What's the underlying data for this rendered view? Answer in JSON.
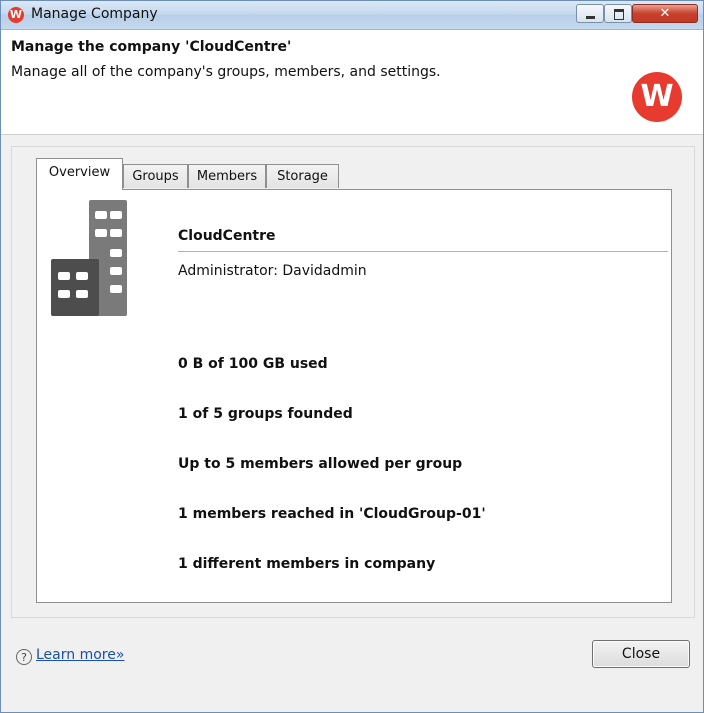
{
  "window": {
    "app_icon_letter": "W",
    "title": "Manage Company",
    "minimize_glyph": "",
    "maximize_glyph": "",
    "close_glyph": "✕"
  },
  "header": {
    "title": "Manage the company 'CloudCentre'",
    "subtitle": "Manage all of the company's groups, members, and settings.",
    "logo_letter": "W"
  },
  "tabs": [
    {
      "label": "Overview",
      "active": true
    },
    {
      "label": "Groups",
      "active": false
    },
    {
      "label": "Members",
      "active": false
    },
    {
      "label": "Storage",
      "active": false
    }
  ],
  "overview": {
    "company_name": "CloudCentre",
    "administrator": "Administrator: Davidadmin",
    "stats": [
      "0 B of 100 GB used",
      "1 of 5 groups founded",
      "Up to 5 members allowed per group",
      "1 members reached in 'CloudGroup-01'",
      "1 different members in company"
    ]
  },
  "footer": {
    "help_glyph": "?",
    "learn_more": "Learn more»",
    "close_label": "Close"
  },
  "colors": {
    "brand": "#e63b2e",
    "link": "#1a4fb0"
  }
}
